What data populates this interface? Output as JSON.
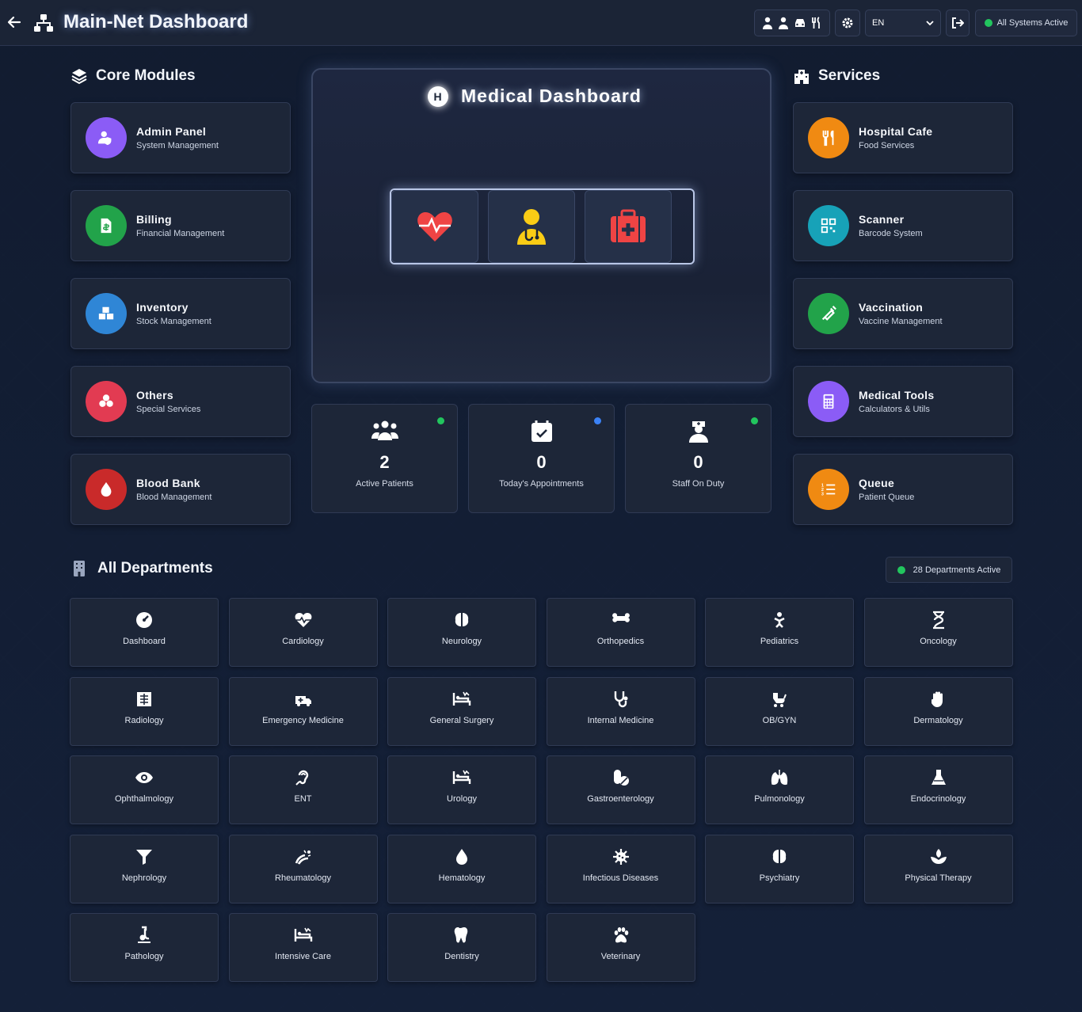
{
  "header": {
    "title": "Main-Net Dashboard",
    "language": "EN",
    "status": "All Systems Active",
    "icons": [
      "doctor-icon",
      "user-icon",
      "car-icon",
      "utensils-icon"
    ]
  },
  "core_modules": {
    "title": "Core Modules",
    "items": [
      {
        "name": "Admin Panel",
        "sub": "System Management",
        "color": "#8b5cf6",
        "icon": "user-shield-icon"
      },
      {
        "name": "Billing",
        "sub": "Financial Management",
        "color": "#22a34a",
        "icon": "invoice-icon"
      },
      {
        "name": "Inventory",
        "sub": "Stock Management",
        "color": "#2f86d6",
        "icon": "boxes-icon"
      },
      {
        "name": "Others",
        "sub": "Special Services",
        "color": "#e23b52",
        "icon": "cubes-icon"
      },
      {
        "name": "Blood Bank",
        "sub": "Blood Management",
        "color": "#c92a2a",
        "icon": "blood-drop-icon"
      }
    ]
  },
  "medical": {
    "title": "Medical Dashboard",
    "badge": "H"
  },
  "stats": [
    {
      "value": "2",
      "label": "Active Patients",
      "dot": "#22c55e",
      "icon": "users-icon"
    },
    {
      "value": "0",
      "label": "Today's Appointments",
      "dot": "#3b82f6",
      "icon": "calendar-check-icon"
    },
    {
      "value": "0",
      "label": "Staff On Duty",
      "dot": "#22c55e",
      "icon": "user-nurse-icon"
    }
  ],
  "services": {
    "title": "Services",
    "items": [
      {
        "name": "Hospital Cafe",
        "sub": "Food Services",
        "color": "#f08a12",
        "icon": "utensils-icon"
      },
      {
        "name": "Scanner",
        "sub": "Barcode System",
        "color": "#17a2b8",
        "icon": "qrcode-icon"
      },
      {
        "name": "Vaccination",
        "sub": "Vaccine Management",
        "color": "#22a34a",
        "icon": "syringe-icon"
      },
      {
        "name": "Medical Tools",
        "sub": "Calculators & Utils",
        "color": "#8b5cf6",
        "icon": "calculator-icon"
      },
      {
        "name": "Queue",
        "sub": "Patient Queue",
        "color": "#f08a12",
        "icon": "list-ol-icon"
      }
    ]
  },
  "departments": {
    "title": "All Departments",
    "badge": "28 Departments Active",
    "items": [
      "Dashboard",
      "Cardiology",
      "Neurology",
      "Orthopedics",
      "Pediatrics",
      "Oncology",
      "Radiology",
      "Emergency Medicine",
      "General Surgery",
      "Internal Medicine",
      "OB/GYN",
      "Dermatology",
      "Ophthalmology",
      "ENT",
      "Urology",
      "Gastroenterology",
      "Pulmonology",
      "Endocrinology",
      "Nephrology",
      "Rheumatology",
      "Hematology",
      "Infectious Diseases",
      "Psychiatry",
      "Physical Therapy",
      "Pathology",
      "Intensive Care",
      "Dentistry",
      "Veterinary"
    ]
  }
}
